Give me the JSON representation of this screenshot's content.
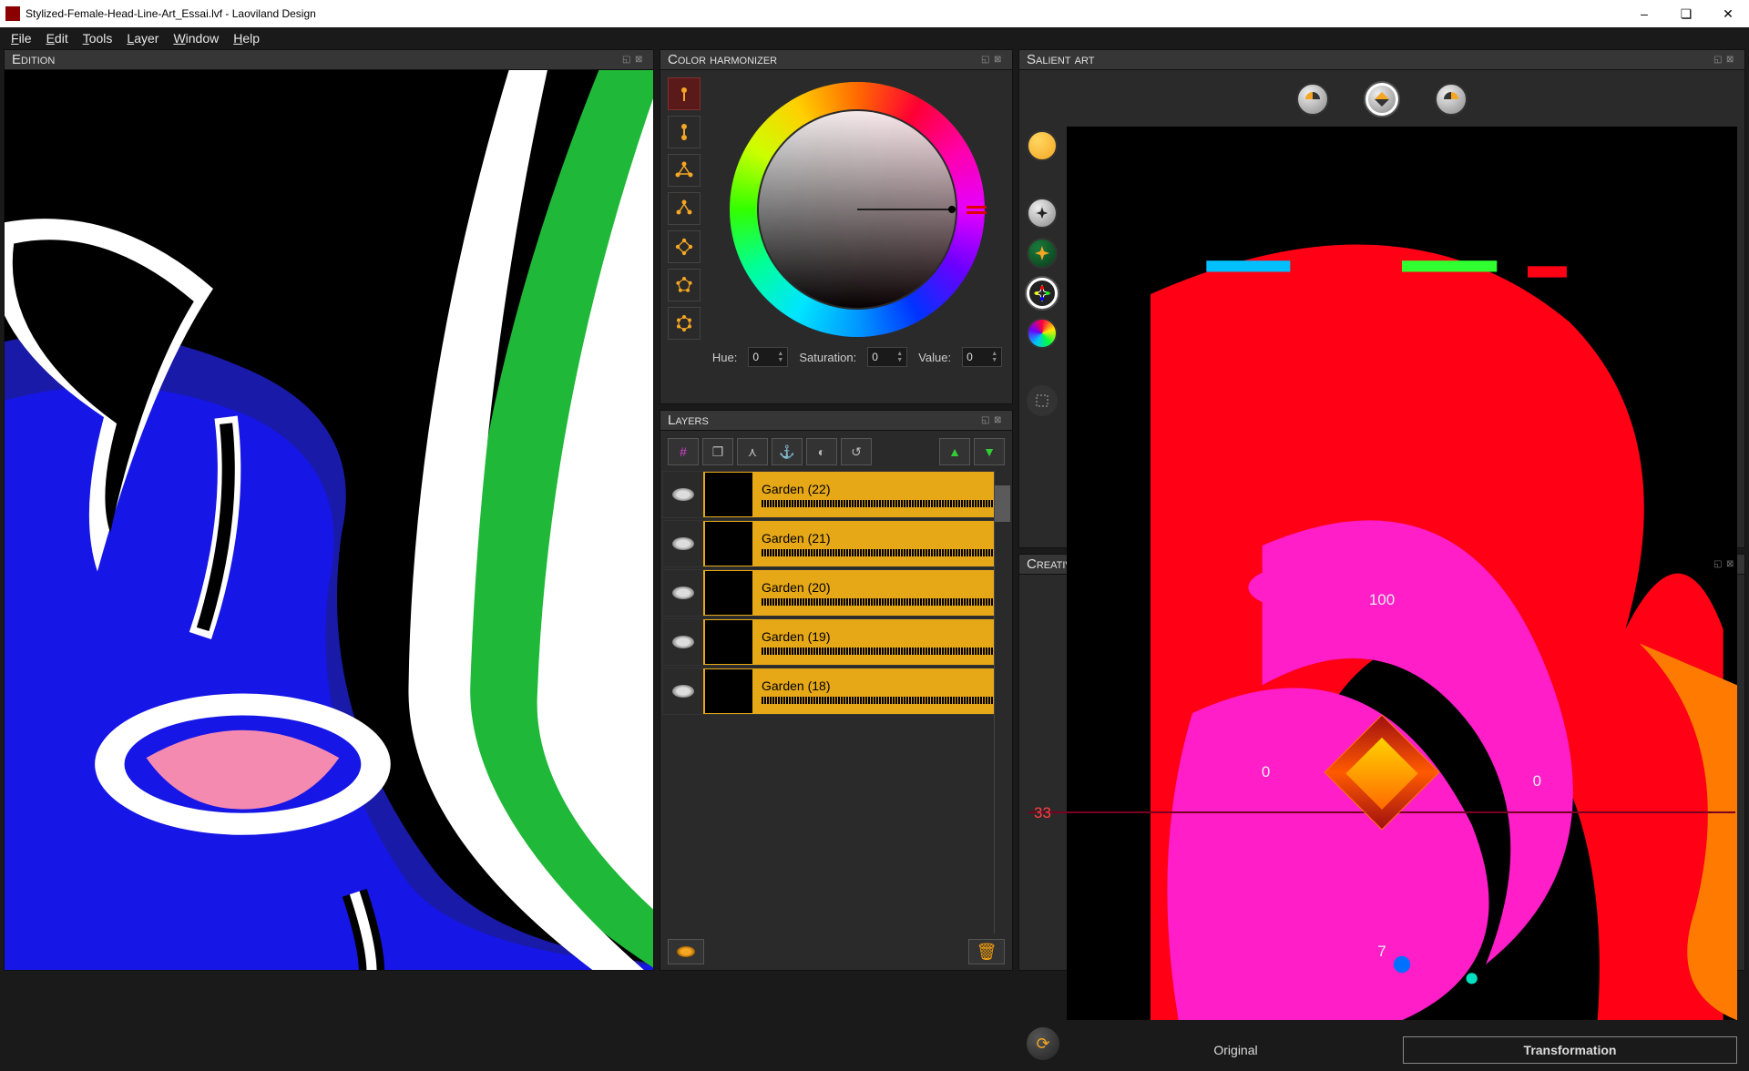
{
  "window": {
    "title": "Stylized-Female-Head-Line-Art_Essai.lvf - Laoviland Design"
  },
  "menu": [
    "File",
    "Edit",
    "Tools",
    "Layer",
    "Window",
    "Help"
  ],
  "edition": {
    "title": "Edition"
  },
  "harmonizer": {
    "title": "Color harmonizer",
    "hue_label": "Hue:",
    "hue": "0",
    "sat_label": "Saturation:",
    "sat": "0",
    "val_label": "Value:",
    "val": "0",
    "schemes": [
      "single",
      "dual",
      "triangle",
      "split",
      "tetra-1",
      "tetra-2",
      "hexa"
    ],
    "selected_scheme": 0
  },
  "layers": {
    "title": "Layers",
    "toolbar": [
      "fx",
      "stack",
      "merge-down",
      "anchor",
      "mask",
      "reset"
    ],
    "rows": [
      {
        "name": "Garden (22)"
      },
      {
        "name": "Garden (21)"
      },
      {
        "name": "Garden (20)"
      },
      {
        "name": "Garden (19)"
      },
      {
        "name": "Garden (18)"
      }
    ]
  },
  "salient": {
    "title": "Salient art",
    "top_modes": [
      "left-pie",
      "mirror-pie",
      "right-pie"
    ],
    "selected_top": 1,
    "side_tools": [
      "gold",
      "star",
      "hue-star",
      "rgb-star",
      "hue-wheel",
      "marquee"
    ],
    "tabs": {
      "original": "Original",
      "transformation": "Transformation",
      "selected": "transformation"
    }
  },
  "creative": {
    "title": "Creative controller",
    "top": "100",
    "left": "0",
    "right": "0",
    "edge": "33",
    "bottom": "7"
  }
}
